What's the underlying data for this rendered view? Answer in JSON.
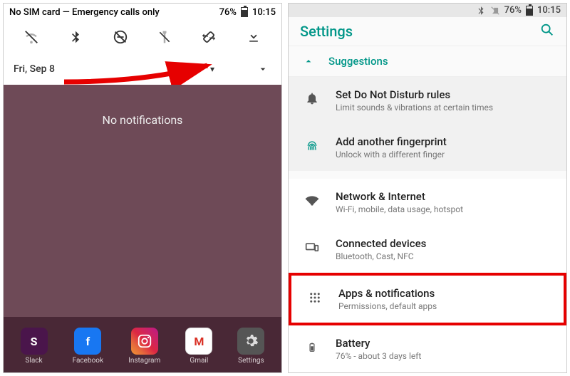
{
  "left": {
    "status": {
      "text": "No SIM card — Emergency calls only",
      "battery_pct": "76%",
      "time": "10:15"
    },
    "quick_settings": [
      {
        "name": "wifi-off-icon"
      },
      {
        "name": "bluetooth-icon"
      },
      {
        "name": "do-not-disturb-off-icon"
      },
      {
        "name": "flashlight-off-icon"
      },
      {
        "name": "autorotate-icon"
      },
      {
        "name": "download-icon"
      }
    ],
    "date": "Fri, Sep 8",
    "no_notifications": "No notifications",
    "dock": [
      {
        "name": "slack",
        "label": "Slack"
      },
      {
        "name": "facebook",
        "label": "Facebook"
      },
      {
        "name": "instagram",
        "label": "Instagram"
      },
      {
        "name": "gmail",
        "label": "Gmail"
      },
      {
        "name": "settings",
        "label": "Settings"
      }
    ]
  },
  "right": {
    "status": {
      "battery_pct": "76%",
      "time": "10:15"
    },
    "app_title": "Settings",
    "suggestions_label": "Suggestions",
    "suggestions": [
      {
        "icon": "bell-icon",
        "title": "Set Do Not Disturb rules",
        "sub": "Limit sounds & vibrations at certain times"
      },
      {
        "icon": "fingerprint-icon",
        "title": "Add another fingerprint",
        "sub": "Unlock with a different finger"
      }
    ],
    "items": [
      {
        "icon": "wifi-icon",
        "title": "Network & Internet",
        "sub": "Wi-Fi, mobile, data usage, hotspot",
        "highlight": false
      },
      {
        "icon": "devices-icon",
        "title": "Connected devices",
        "sub": "Bluetooth, Cast, NFC",
        "highlight": false
      },
      {
        "icon": "apps-icon",
        "title": "Apps & notifications",
        "sub": "Permissions, default apps",
        "highlight": true
      },
      {
        "icon": "battery-icon",
        "title": "Battery",
        "sub": "76% - about 3 days left",
        "highlight": false
      }
    ]
  },
  "colors": {
    "accent": "#009688",
    "highlight": "#e60000"
  }
}
